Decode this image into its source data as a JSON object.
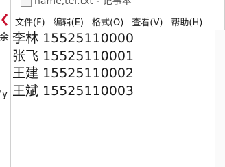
{
  "window": {
    "title": "name,tel.txt - 记事本",
    "background": "#ffffff"
  },
  "left_strip": {
    "fragments": [
      "余",
      "'y"
    ],
    "accent_color": "#c8102e"
  },
  "menu": {
    "items": [
      {
        "label": "文件(F)"
      },
      {
        "label": "编辑(E)"
      },
      {
        "label": "格式(O)"
      },
      {
        "label": "查看(V)"
      },
      {
        "label": "帮助(H)"
      }
    ]
  },
  "editor": {
    "lines": [
      "李林 15525110000",
      "张飞 15525110001",
      "王建 15525110002",
      "王斌 15525110003"
    ]
  }
}
